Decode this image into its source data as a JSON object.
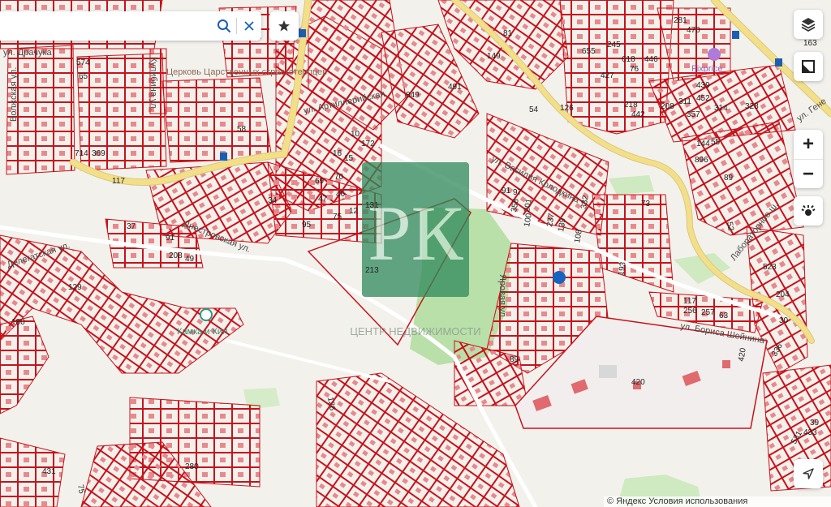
{
  "search": {
    "value": "",
    "placeholder": ""
  },
  "icons": {
    "search": "search-icon",
    "clear": "close-icon",
    "bookmark": "star-icon",
    "layers": "layers-icon",
    "ruler": "ruler-icon",
    "traffic": "traffic-icon",
    "geolocation": "navigation-arrow-icon"
  },
  "zoom": {
    "in_label": "+",
    "out_label": "−"
  },
  "colors": {
    "cadastral_line": "#c8121b",
    "building_fill": "#e8898c",
    "park": "#b9e0a8",
    "road_major": "#f3df8a",
    "watermark": "#2f8a5c",
    "location_pin": "#1565c0"
  },
  "watermark": {
    "letters": "РК",
    "caption": "ЦЕНТР НЕДВИЖИМОСТИ"
  },
  "streets": {
    "drachuka": "ул. Драчука",
    "volzhskaya": "Волжская ул.",
    "kulibina": "Кулибина ул.",
    "artilleriyskaya": "ул. Артиллерийская",
    "vasiliya_kolodkina": "ул. Василия Колодкина",
    "delegatskaya": "Делегатская ул.",
    "dnestrovskaya": "Днестровская ул.",
    "borisa_sheynina": "ул. Бориса Шейнина",
    "laboratornoe": "Лабораторное ш.",
    "genera": "ул. Гене",
    "yarovaya": "Яровая ул."
  },
  "pois": {
    "church": "Церковь Царственных страстотерпцев",
    "kamchatka": "Камка и Кил",
    "store": "Fixprice"
  },
  "plots": {
    "n213": "213",
    "n420a": "420",
    "n420b": "420",
    "n574": "574",
    "n65": "65",
    "n714": "714",
    "n369": "369",
    "n117a": "117",
    "n117b": "117",
    "n58": "58",
    "n129": "129",
    "n180": "180",
    "n126a": "126",
    "n126b": "126",
    "n280": "280",
    "n431": "431",
    "n91": "91",
    "n208": "208",
    "n49": "49",
    "n37": "37",
    "n69": "69",
    "n70": "70",
    "n47": "47",
    "n46": "46",
    "n75": "75",
    "n12": "12",
    "n131": "131",
    "n95": "95",
    "n34": "34",
    "n10": "10",
    "n15": "15",
    "n16": "16",
    "n172": "172",
    "n849": "849",
    "n491": "491",
    "n54": "54",
    "n81": "81",
    "n149": "149",
    "n655": "655",
    "n427": "427",
    "n245": "245",
    "n618": "618",
    "n76": "76",
    "n446": "446",
    "n218": "218",
    "n442": "442",
    "n208b": "208",
    "n311": "311",
    "n357": "357",
    "n439": "439",
    "n452": "452",
    "n314": "314",
    "n328": "328",
    "n281": "281",
    "n470": "470",
    "n163": "163",
    "n144": "144",
    "n55": "55",
    "n896": "896",
    "n89a": "89",
    "n89b": "89",
    "n91b": "91",
    "n97": "97",
    "n358": "358",
    "n201": "201",
    "n100": "100",
    "n237": "237",
    "n139": "139",
    "n108": "108",
    "n332": "332",
    "n193": "193",
    "n73": "73",
    "n256": "256",
    "n257": "257",
    "n63": "63",
    "n30": "30",
    "n204": "204",
    "n523": "523",
    "n336": "336",
    "n39": "39",
    "n433": "433",
    "n531": "531",
    "n52": "52",
    "n75b": "75"
  },
  "copyright": "© Яндекс Условия использования"
}
